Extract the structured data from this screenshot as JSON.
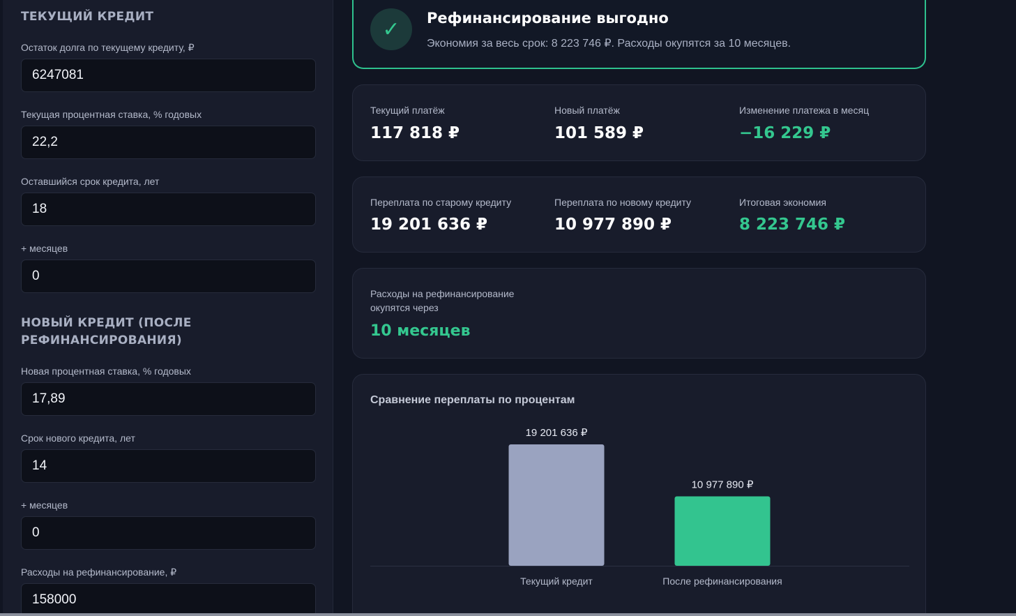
{
  "current_loan": {
    "title": "ТЕКУЩИЙ КРЕДИТ",
    "debt_label": "Остаток долга по текущему кредиту, ₽",
    "debt_value": "6247081",
    "rate_label": "Текущая процентная ставка, % годовых",
    "rate_value": "22,2",
    "term_years_label": "Оставшийся срок кредита, лет",
    "term_years_value": "18",
    "term_months_label": "+ месяцев",
    "term_months_value": "0"
  },
  "new_loan": {
    "title": "НОВЫЙ КРЕДИТ (ПОСЛЕ РЕФИНАНСИРОВАНИЯ)",
    "rate_label": "Новая процентная ставка, % годовых",
    "rate_value": "17,89",
    "term_years_label": "Срок нового кредита, лет",
    "term_years_value": "14",
    "term_months_label": "+ месяцев",
    "term_months_value": "0",
    "costs_label": "Расходы на рефинансирование, ₽",
    "costs_value": "158000"
  },
  "banner": {
    "check": "✓",
    "title": "Рефинансирование выгодно",
    "text": "Экономия за весь срок: 8 223 746 ₽. Расходы окупятся за 10 месяцев."
  },
  "payments": {
    "current_label": "Текущий платёж",
    "current_value": "117 818 ₽",
    "new_label": "Новый платёж",
    "new_value": "101 589 ₽",
    "change_label": "Изменение платежа в месяц",
    "change_value": "−16 229 ₽"
  },
  "overpayment": {
    "old_label": "Переплата по старому кредиту",
    "old_value": "19 201 636 ₽",
    "new_label": "Переплата по новому кредиту",
    "new_value": "10 977 890 ₽",
    "savings_label": "Итоговая экономия",
    "savings_value": "8 223 746 ₽"
  },
  "payback": {
    "label": "Расходы на рефинансирование окупятся через",
    "value": "10 месяцев"
  },
  "colors": {
    "accent_green": "#34c78f",
    "bar_current": "#9aa3c0",
    "bar_new": "#33c48f"
  },
  "chart_data": {
    "type": "bar",
    "title": "Сравнение переплаты по процентам",
    "categories": [
      "Текущий кредит",
      "После рефинансирования"
    ],
    "values": [
      19201636,
      10977890
    ],
    "value_labels": [
      "19 201 636 ₽",
      "10 977 890 ₽"
    ],
    "colors": [
      "#9aa3c0",
      "#33c48f"
    ],
    "xlabel": "",
    "ylabel": "",
    "ylim": [
      0,
      19201636
    ],
    "grid": false,
    "legend": "none"
  }
}
